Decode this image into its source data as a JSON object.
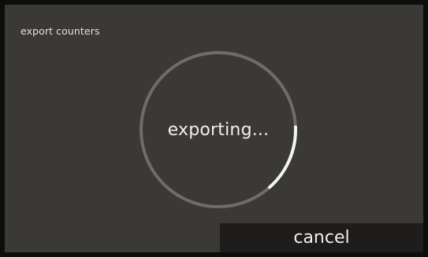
{
  "dialog": {
    "title": "export counters",
    "status_text": "exporting...",
    "cancel_label": "cancel"
  },
  "progress": {
    "fraction": 0.14,
    "track_color": "#6f6d69",
    "fill_color": "#f4f4f2"
  },
  "icons": {
    "spinner": "progress-ring-icon"
  }
}
